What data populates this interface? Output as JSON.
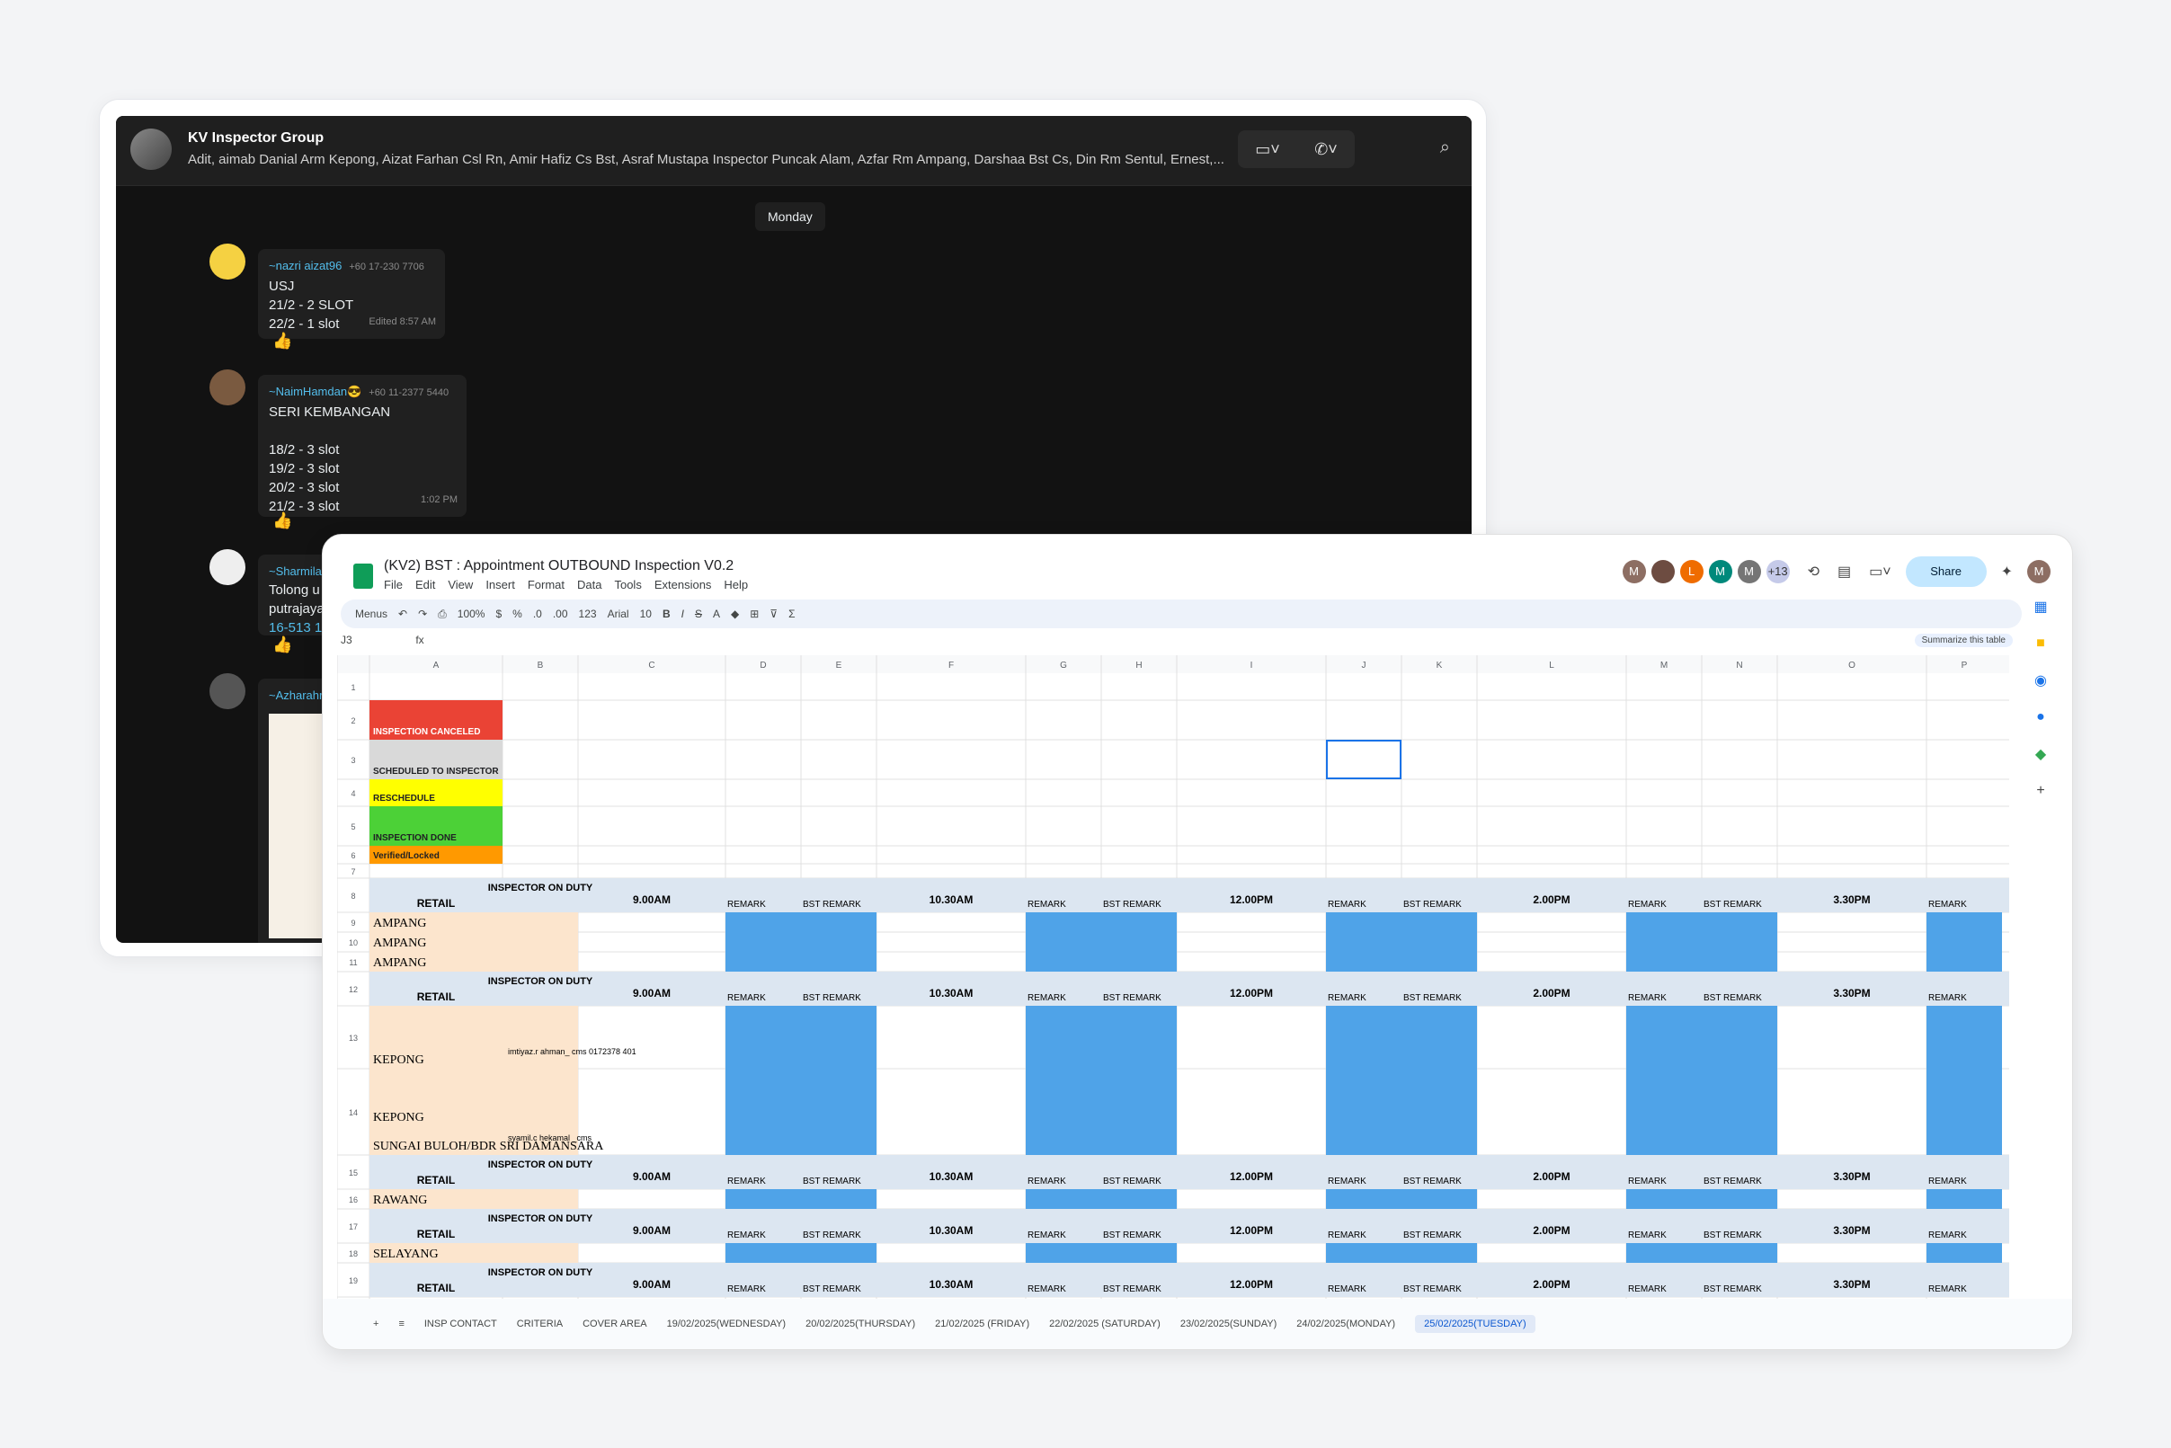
{
  "chat": {
    "group_title": "KV Inspector Group",
    "members": "Adit, aimab Danial Arm Kepong, Aizat Farhan Csl Rn, Amir Hafiz Cs Bst, Asraf Mustapa Inspector Puncak Alam, Azfar Rm Ampang, Darshaa Bst Cs, Din Rm Sentul, Ernest,...",
    "day": "Monday",
    "messages": [
      {
        "sender": "~nazri aizat96",
        "phone": "+60 17-230 7706",
        "lines": [
          "USJ",
          "21/2 - 2 SLOT",
          "22/2 - 1 slot"
        ],
        "meta": "Edited 8:57 AM",
        "reaction": "👍"
      },
      {
        "sender": "~NaimHamdan😎",
        "phone": "+60 11-2377 5440",
        "lines": [
          "SERI KEMBANGAN",
          "",
          "18/2 - 3 slot",
          "19/2 - 3 slot",
          "20/2 - 3 slot",
          "21/2 - 3 slot"
        ],
        "meta": "1:02 PM",
        "reaction": "👍"
      },
      {
        "sender": "~Sharmila",
        "phone": "",
        "lines": [
          "Tolong u",
          "putrajaya",
          "16-513 1"
        ],
        "meta": "",
        "reaction": "👍"
      },
      {
        "sender": "~Azharahr",
        "phone": "",
        "lines": [],
        "meta": "",
        "reaction": ""
      }
    ]
  },
  "sheet": {
    "title": "(KV2) BST : Appointment OUTBOUND Inspection V0.2",
    "menu": [
      "File",
      "Edit",
      "View",
      "Insert",
      "Format",
      "Data",
      "Tools",
      "Extensions",
      "Help"
    ],
    "toolbar": {
      "menus": "Menus",
      "zoom": "100%",
      "font": "Arial",
      "size": "10",
      "currency": "$",
      "percent": "%",
      "dec_less": ".0",
      "dec_more": ".00",
      "num": "123"
    },
    "avatars": [
      {
        "l": "M",
        "c": "#8d6e63"
      },
      {
        "l": "",
        "c": "#6d4c41"
      },
      {
        "l": "L",
        "c": "#ef6c00"
      },
      {
        "l": "M",
        "c": "#00897b"
      },
      {
        "l": "M",
        "c": "#757575"
      },
      {
        "l": "+13",
        "c": "#c5cae9"
      }
    ],
    "share": "Share",
    "user_avatar": "M",
    "cell_ref": "J3",
    "fx": "fx",
    "summarize": "Summarize this table",
    "columns": [
      "A",
      "B",
      "C",
      "D",
      "E",
      "F",
      "G",
      "H",
      "I",
      "J",
      "K",
      "L",
      "M",
      "N",
      "O",
      "P"
    ],
    "legend": [
      {
        "label": "INSPECTION CANCELED",
        "color": "#ea4335"
      },
      {
        "label": "SCHEDULED TO INSPECTOR",
        "color": "#d9d9d9"
      },
      {
        "label": "RESCHEDULE",
        "color": "#ffff00"
      },
      {
        "label": "INSPECTION DONE",
        "color": "#4cd137"
      },
      {
        "label": "Verified/Locked",
        "color": "#ff9900"
      }
    ],
    "header_row": {
      "retail": "RETAIL",
      "inspector": "INSPECTOR ON DUTY",
      "slots": [
        "9.00AM",
        "10.30AM",
        "12.00PM",
        "2.00PM",
        "3.30PM"
      ],
      "remark": "REMARK",
      "bst_remark": "BST REMARK"
    },
    "rows": [
      {
        "n": "9",
        "a": "AMPANG",
        "b": ""
      },
      {
        "n": "10",
        "a": "AMPANG",
        "b": ""
      },
      {
        "n": "11",
        "a": "AMPANG",
        "b": ""
      },
      {
        "n": "13",
        "a": "KEPONG",
        "b": "imtiyaz.r ahman_ cms 0172378 401"
      },
      {
        "n": "14",
        "a": "KEPONG\n\nSUNGAI BULOH/BDR SRI DAMANSARA",
        "b": "syamil.c hekamal _cms"
      },
      {
        "n": "16",
        "a": "RAWANG",
        "b": ""
      },
      {
        "n": "18",
        "a": "SELAYANG",
        "b": ""
      }
    ],
    "tabs": [
      "INSP CONTACT",
      "CRITERIA",
      "COVER AREA",
      "19/02/2025(WEDNESDAY)",
      "20/02/2025(THURSDAY)",
      "21/02/2025 (FRIDAY)",
      "22/02/2025 (SATURDAY)",
      "23/02/2025(SUNDAY)",
      "24/02/2025(MONDAY)",
      "25/02/2025(TUESDAY)"
    ],
    "active_tab": "25/02/2025(TUESDAY)"
  }
}
